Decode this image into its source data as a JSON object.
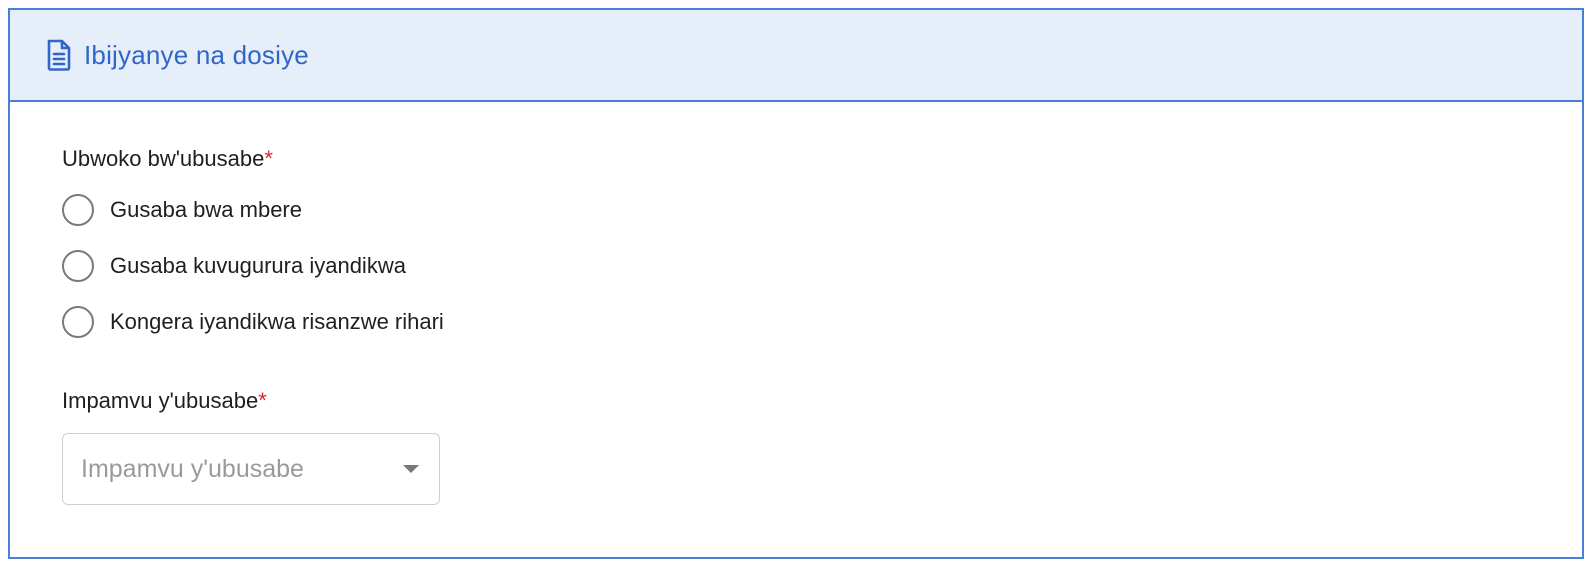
{
  "section": {
    "title": "Ibijyanye na dosiye",
    "icon": "document-icon",
    "accent_color": "#3066c9",
    "header_bg": "#e6eefa",
    "border_color": "#4a7fd6"
  },
  "request_type": {
    "label": "Ubwoko bw'ubusabe",
    "required_marker": "*",
    "options": [
      {
        "label": "Gusaba bwa mbere",
        "selected": false
      },
      {
        "label": "Gusaba kuvugurura iyandikwa",
        "selected": false
      },
      {
        "label": "Kongera iyandikwa risanzwe rihari",
        "selected": false
      }
    ]
  },
  "request_reason": {
    "label": "Impamvu y'ubusabe",
    "required_marker": "*",
    "placeholder": "Impamvu y'ubusabe",
    "icon": "chevron-down-icon"
  },
  "colors": {
    "required": "#d6263b"
  }
}
